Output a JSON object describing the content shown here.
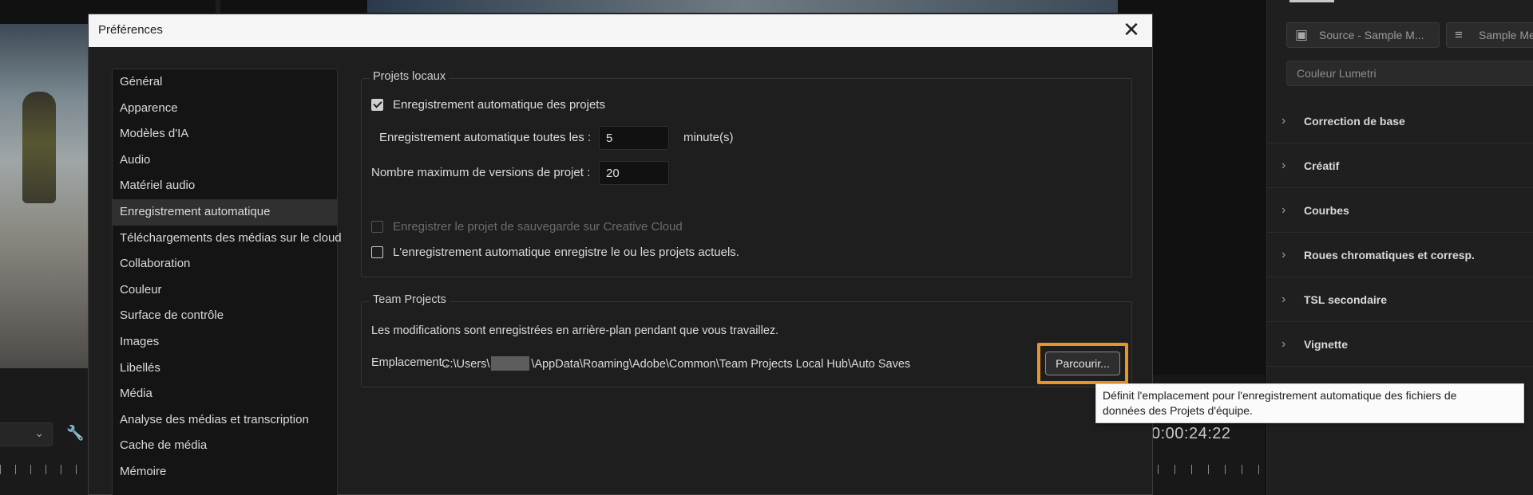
{
  "dialog": {
    "title": "Préférences",
    "close_symbol": "✕"
  },
  "categories": [
    "Général",
    "Apparence",
    "Modèles d'IA",
    "Audio",
    "Matériel audio",
    "Enregistrement automatique",
    "Téléchargements des médias sur le cloud",
    "Collaboration",
    "Couleur",
    "Surface de contrôle",
    "Images",
    "Libellés",
    "Média",
    "Analyse des médias et transcription",
    "Cache de média",
    "Mémoire"
  ],
  "selected_category": "Enregistrement automatique",
  "local_projects": {
    "legend": "Projets locaux",
    "auto_save_label": "Enregistrement automatique des projets",
    "auto_save_checked": true,
    "interval_label": "Enregistrement automatique toutes les :",
    "interval_value": "5",
    "interval_unit": "minute(s)",
    "max_versions_label": "Nombre maximum de versions de projet :",
    "max_versions_value": "20",
    "cloud_backup_label": "Enregistrer le projet de sauvegarde sur Creative Cloud",
    "cloud_backup_checked": false,
    "current_projects_label": "L'enregistrement automatique enregistre le ou les projets actuels.",
    "current_projects_checked": false
  },
  "team_projects": {
    "legend": "Team Projects",
    "description": "Les modifications sont enregistrées en arrière-plan pendant que vous travaillez.",
    "location_label": "Emplacement :",
    "path_prefix": "C:\\Users\\",
    "path_suffix": "\\AppData\\Roaming\\Adobe\\Common\\Team Projects Local Hub\\Auto Saves",
    "browse_label": "Parcourir..."
  },
  "tooltip": {
    "line1": "Définit l'emplacement pour l'enregistrement automatique des fichiers de",
    "line2": "données des Projets d'équipe."
  },
  "background": {
    "timecode": "0:00:24:22",
    "right_panel": {
      "tab1": "Source - Sample M...",
      "tab2": "Sample Me",
      "panel_title": "Couleur Lumetri",
      "sections": [
        "Correction de base",
        "Créatif",
        "Courbes",
        "Roues chromatiques et corresp.",
        "TSL secondaire",
        "Vignette"
      ]
    }
  },
  "colors": {
    "accent_highlight": "#e8942a",
    "dialog_bg": "#1e1e1e",
    "list_bg": "#141414"
  }
}
